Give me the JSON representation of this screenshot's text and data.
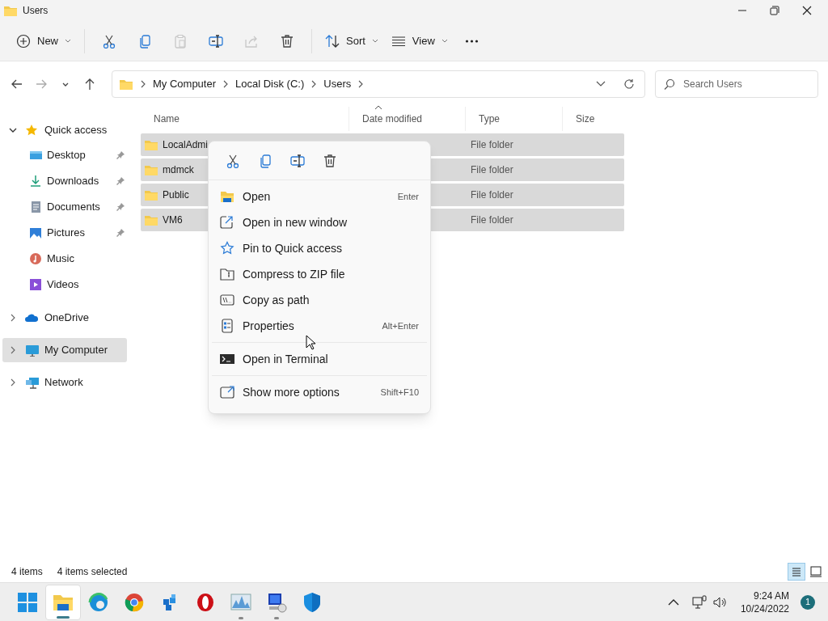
{
  "window": {
    "title": "Users"
  },
  "toolbar": [
    {
      "kind": "new",
      "label": "New",
      "disabled": false
    },
    {
      "kind": "cut",
      "disabled": false
    },
    {
      "kind": "copy",
      "disabled": false
    },
    {
      "kind": "paste",
      "disabled": true
    },
    {
      "kind": "rename",
      "disabled": false
    },
    {
      "kind": "share",
      "disabled": true
    },
    {
      "kind": "delete",
      "disabled": false
    },
    {
      "kind": "sort",
      "label": "Sort",
      "disabled": false
    },
    {
      "kind": "view",
      "label": "View",
      "disabled": false
    },
    {
      "kind": "more",
      "disabled": false
    }
  ],
  "navigation": [
    {
      "kind": "back",
      "disabled": false
    },
    {
      "kind": "forward",
      "disabled": true
    },
    {
      "kind": "recent",
      "disabled": false
    },
    {
      "kind": "up",
      "disabled": false
    }
  ],
  "breadcrumb": [
    "My Computer",
    "Local Disk (C:)",
    "Users"
  ],
  "search": {
    "placeholder": "Search Users"
  },
  "sidebar": {
    "items": [
      {
        "kind": "star",
        "label": "Quick access",
        "expanded": true,
        "selected": false,
        "children": [
          {
            "kind": "desktop",
            "label": "Desktop",
            "pinned": true
          },
          {
            "kind": "downloads",
            "label": "Downloads",
            "pinned": true
          },
          {
            "kind": "documents",
            "label": "Documents",
            "pinned": true
          },
          {
            "kind": "pictures",
            "label": "Pictures",
            "pinned": true
          },
          {
            "kind": "music",
            "label": "Music",
            "pinned": false
          },
          {
            "kind": "videos",
            "label": "Videos",
            "pinned": false
          }
        ]
      },
      {
        "kind": "cloud",
        "label": "OneDrive",
        "expanded": false,
        "selected": false
      },
      {
        "kind": "computer",
        "label": "My Computer",
        "expanded": false,
        "selected": true
      },
      {
        "kind": "network",
        "label": "Network",
        "expanded": false,
        "selected": false
      }
    ]
  },
  "table": {
    "columns": [
      "Name",
      "Date modified",
      "Type",
      "Size"
    ],
    "rows": [
      {
        "name": "LocalAdmi",
        "type": "File folder",
        "selected": true
      },
      {
        "name": "mdmck",
        "type": "File folder",
        "selected": true
      },
      {
        "name": "Public",
        "type": "File folder",
        "selected": true
      },
      {
        "name": "VM6",
        "type": "File folder",
        "selected": true
      }
    ]
  },
  "context_menu": {
    "quick_actions": [
      {
        "kind": "cut"
      },
      {
        "kind": "copy"
      },
      {
        "kind": "rename"
      },
      {
        "kind": "delete"
      }
    ],
    "groups": [
      [
        {
          "kind": "open",
          "label": "Open",
          "shortcut": "Enter"
        },
        {
          "kind": "newwindow",
          "label": "Open in new window"
        },
        {
          "kind": "pin",
          "label": "Pin to Quick access"
        },
        {
          "kind": "zip",
          "label": "Compress to ZIP file"
        },
        {
          "kind": "path",
          "label": "Copy as path"
        },
        {
          "kind": "properties",
          "label": "Properties",
          "shortcut": "Alt+Enter"
        }
      ],
      [
        {
          "kind": "terminal",
          "label": "Open in Terminal"
        }
      ],
      [
        {
          "kind": "more",
          "label": "Show more options",
          "shortcut": "Shift+F10"
        }
      ]
    ]
  },
  "status_bar": {
    "count": "4 items",
    "selection": "4 items selected",
    "views": [
      {
        "kind": "details",
        "selected": true
      },
      {
        "kind": "tiles",
        "selected": false
      }
    ]
  },
  "taskbar": {
    "apps": [
      {
        "kind": "start",
        "running": false,
        "selected": false
      },
      {
        "kind": "explorer",
        "running": true,
        "selected": true
      },
      {
        "kind": "edge",
        "running": false,
        "selected": false
      },
      {
        "kind": "chrome",
        "running": false,
        "selected": false
      },
      {
        "kind": "cubes",
        "running": false,
        "selected": false
      },
      {
        "kind": "opera",
        "running": false,
        "selected": false
      },
      {
        "kind": "monitor",
        "running": true,
        "selected": false
      },
      {
        "kind": "remote",
        "running": true,
        "selected": false
      },
      {
        "kind": "shield",
        "running": false,
        "selected": false
      }
    ],
    "time": "9:24 AM",
    "date": "10/24/2022",
    "notifications": "1"
  }
}
